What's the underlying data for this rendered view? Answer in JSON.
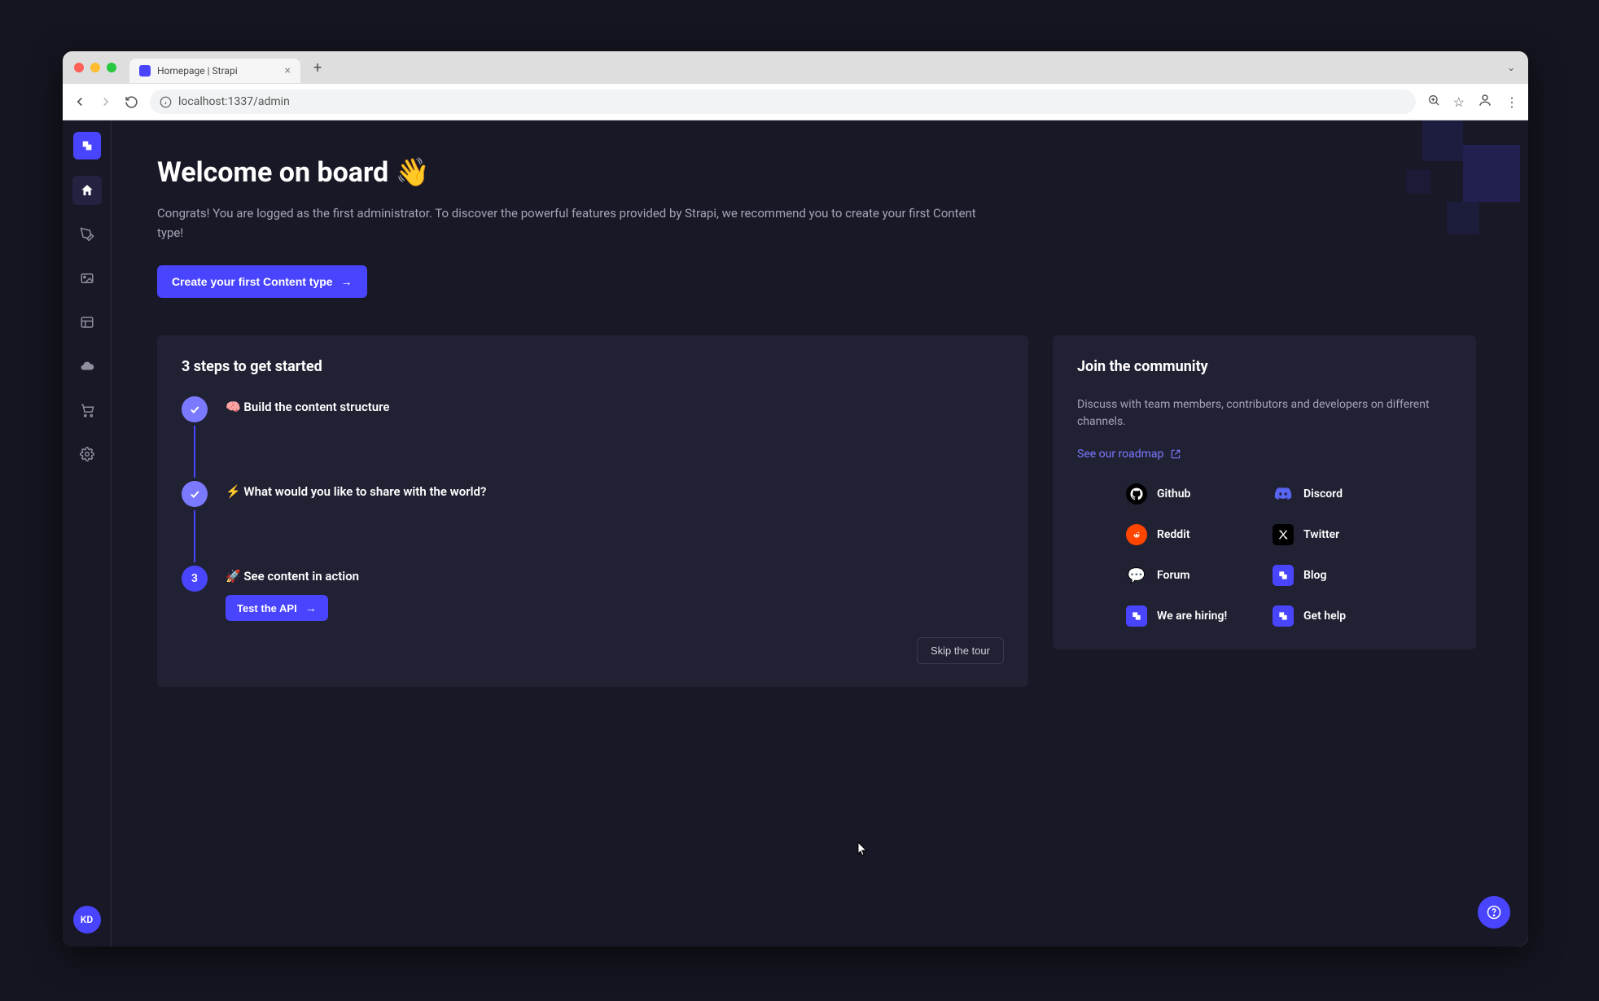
{
  "browser": {
    "tabTitle": "Homepage | Strapi",
    "url": "localhost:1337/admin"
  },
  "sidebar": {
    "avatarInitials": "KD"
  },
  "header": {
    "title": "Welcome on board 👋",
    "subtitle": "Congrats! You are logged as the first administrator. To discover the powerful features provided by Strapi, we recommend you to create your first Content type!",
    "ctaLabel": "Create your first Content type"
  },
  "steps": {
    "title": "3 steps to get started",
    "items": [
      {
        "marker": "check",
        "label": "🧠 Build the content structure"
      },
      {
        "marker": "check",
        "label": "⚡ What would you like to share with the world?"
      },
      {
        "marker": "3",
        "label": "🚀 See content in action",
        "action": "Test the API"
      }
    ],
    "skipLabel": "Skip the tour"
  },
  "community": {
    "title": "Join the community",
    "desc": "Discuss with team members, contributors and developers on different channels.",
    "roadmapLabel": "See our roadmap",
    "links": [
      {
        "id": "github",
        "label": "Github"
      },
      {
        "id": "discord",
        "label": "Discord"
      },
      {
        "id": "reddit",
        "label": "Reddit"
      },
      {
        "id": "twitter",
        "label": "Twitter"
      },
      {
        "id": "forum",
        "label": "Forum"
      },
      {
        "id": "blog",
        "label": "Blog"
      },
      {
        "id": "hiring",
        "label": "We are hiring!"
      },
      {
        "id": "help",
        "label": "Get help"
      }
    ]
  }
}
